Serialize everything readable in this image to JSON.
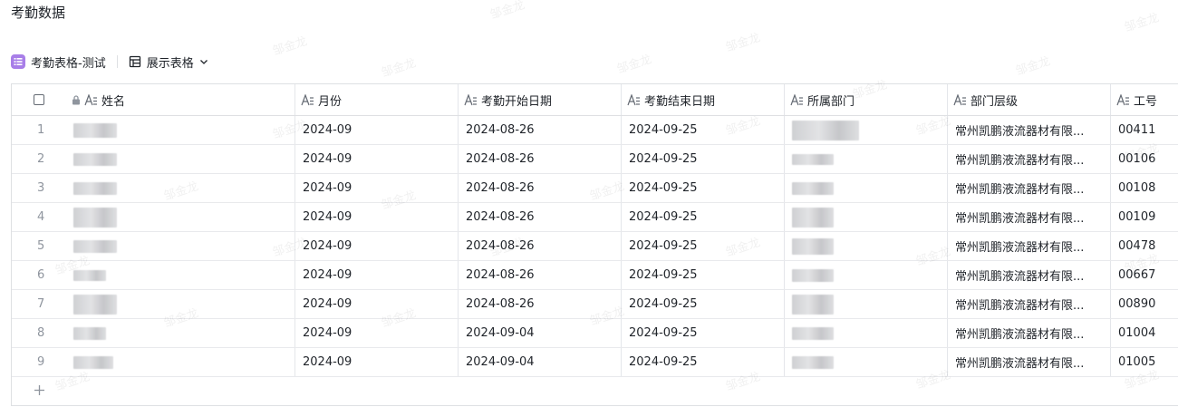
{
  "page": {
    "title": "考勤数据"
  },
  "toolbar": {
    "table_name": "考勤表格-测试",
    "view_name": "展示表格"
  },
  "columns": {
    "name": "姓名",
    "month": "月份",
    "start_date": "考勤开始日期",
    "end_date": "考勤结束日期",
    "department": "所属部门",
    "dept_level": "部门层级",
    "employee_id": "工号"
  },
  "rows": [
    {
      "index": "1",
      "month": "2024-09",
      "start": "2024-08-26",
      "end": "2024-09-25",
      "level": "常州凯鹏液流器材有限...",
      "id": "00411"
    },
    {
      "index": "2",
      "month": "2024-09",
      "start": "2024-08-26",
      "end": "2024-09-25",
      "level": "常州凯鹏液流器材有限...",
      "id": "00106"
    },
    {
      "index": "3",
      "month": "2024-09",
      "start": "2024-08-26",
      "end": "2024-09-25",
      "level": "常州凯鹏液流器材有限...",
      "id": "00108"
    },
    {
      "index": "4",
      "month": "2024-09",
      "start": "2024-08-26",
      "end": "2024-09-25",
      "level": "常州凯鹏液流器材有限...",
      "id": "00109"
    },
    {
      "index": "5",
      "month": "2024-09",
      "start": "2024-08-26",
      "end": "2024-09-25",
      "level": "常州凯鹏液流器材有限...",
      "id": "00478"
    },
    {
      "index": "6",
      "month": "2024-09",
      "start": "2024-08-26",
      "end": "2024-09-25",
      "level": "常州凯鹏液流器材有限...",
      "id": "00667"
    },
    {
      "index": "7",
      "month": "2024-09",
      "start": "2024-08-26",
      "end": "2024-09-25",
      "level": "常州凯鹏液流器材有限...",
      "id": "00890"
    },
    {
      "index": "8",
      "month": "2024-09",
      "start": "2024-09-04",
      "end": "2024-09-25",
      "level": "常州凯鹏液流器材有限...",
      "id": "01004"
    },
    {
      "index": "9",
      "month": "2024-09",
      "start": "2024-09-04",
      "end": "2024-09-25",
      "level": "常州凯鹏液流器材有限...",
      "id": "01005"
    }
  ],
  "watermark": {
    "text": "邹金龙"
  },
  "icons": {
    "table_badge": "list-icon",
    "view": "grid-table-icon",
    "view_menu": "chevron-down-icon",
    "field_type": "text-field-icon",
    "lock": "lock-icon",
    "add_row": "plus-icon"
  },
  "colors": {
    "accent": "#a87ee8",
    "border": "#dee0e3",
    "text": "#1f2329",
    "muted": "#8f959e"
  }
}
